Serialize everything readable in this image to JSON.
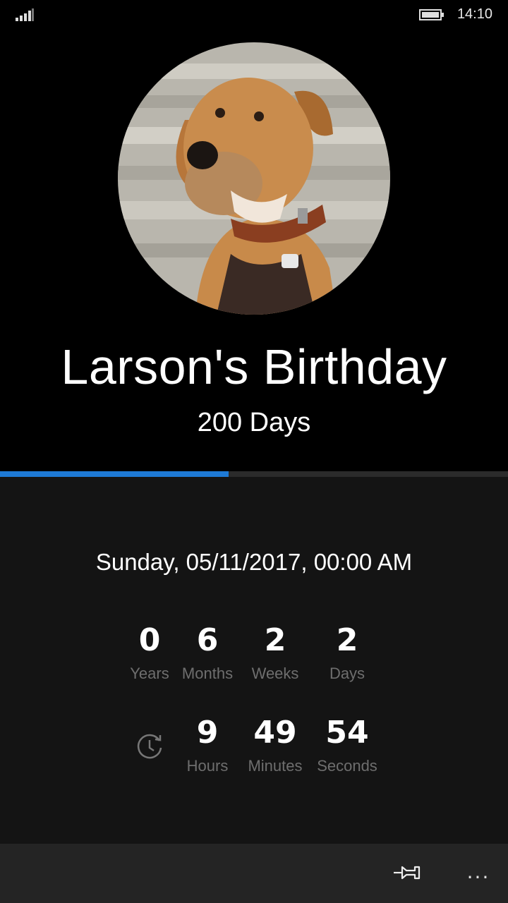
{
  "status_bar": {
    "time": "14:10",
    "signal_icon": "signal-bars-icon",
    "battery_icon": "battery-icon"
  },
  "event": {
    "title": "Larson's Birthday",
    "days_label": "200 Days",
    "progress_fraction": 0.45,
    "date_time": "Sunday, 05/11/2017, 00:00 AM",
    "photo": "dog-photo"
  },
  "countdown": {
    "years": {
      "value": "0",
      "label": "Years"
    },
    "months": {
      "value": "6",
      "label": "Months"
    },
    "weeks": {
      "value": "2",
      "label": "Weeks"
    },
    "days": {
      "value": "2",
      "label": "Days"
    },
    "hours": {
      "value": "9",
      "label": "Hours"
    },
    "minutes": {
      "value": "49",
      "label": "Minutes"
    },
    "seconds": {
      "value": "54",
      "label": "Seconds"
    }
  },
  "app_bar": {
    "pin_icon": "pin-icon",
    "more_label": "..."
  },
  "colors": {
    "accent": "#1e7ad6",
    "background": "#000000",
    "panel": "#141414",
    "app_bar": "#242424"
  }
}
